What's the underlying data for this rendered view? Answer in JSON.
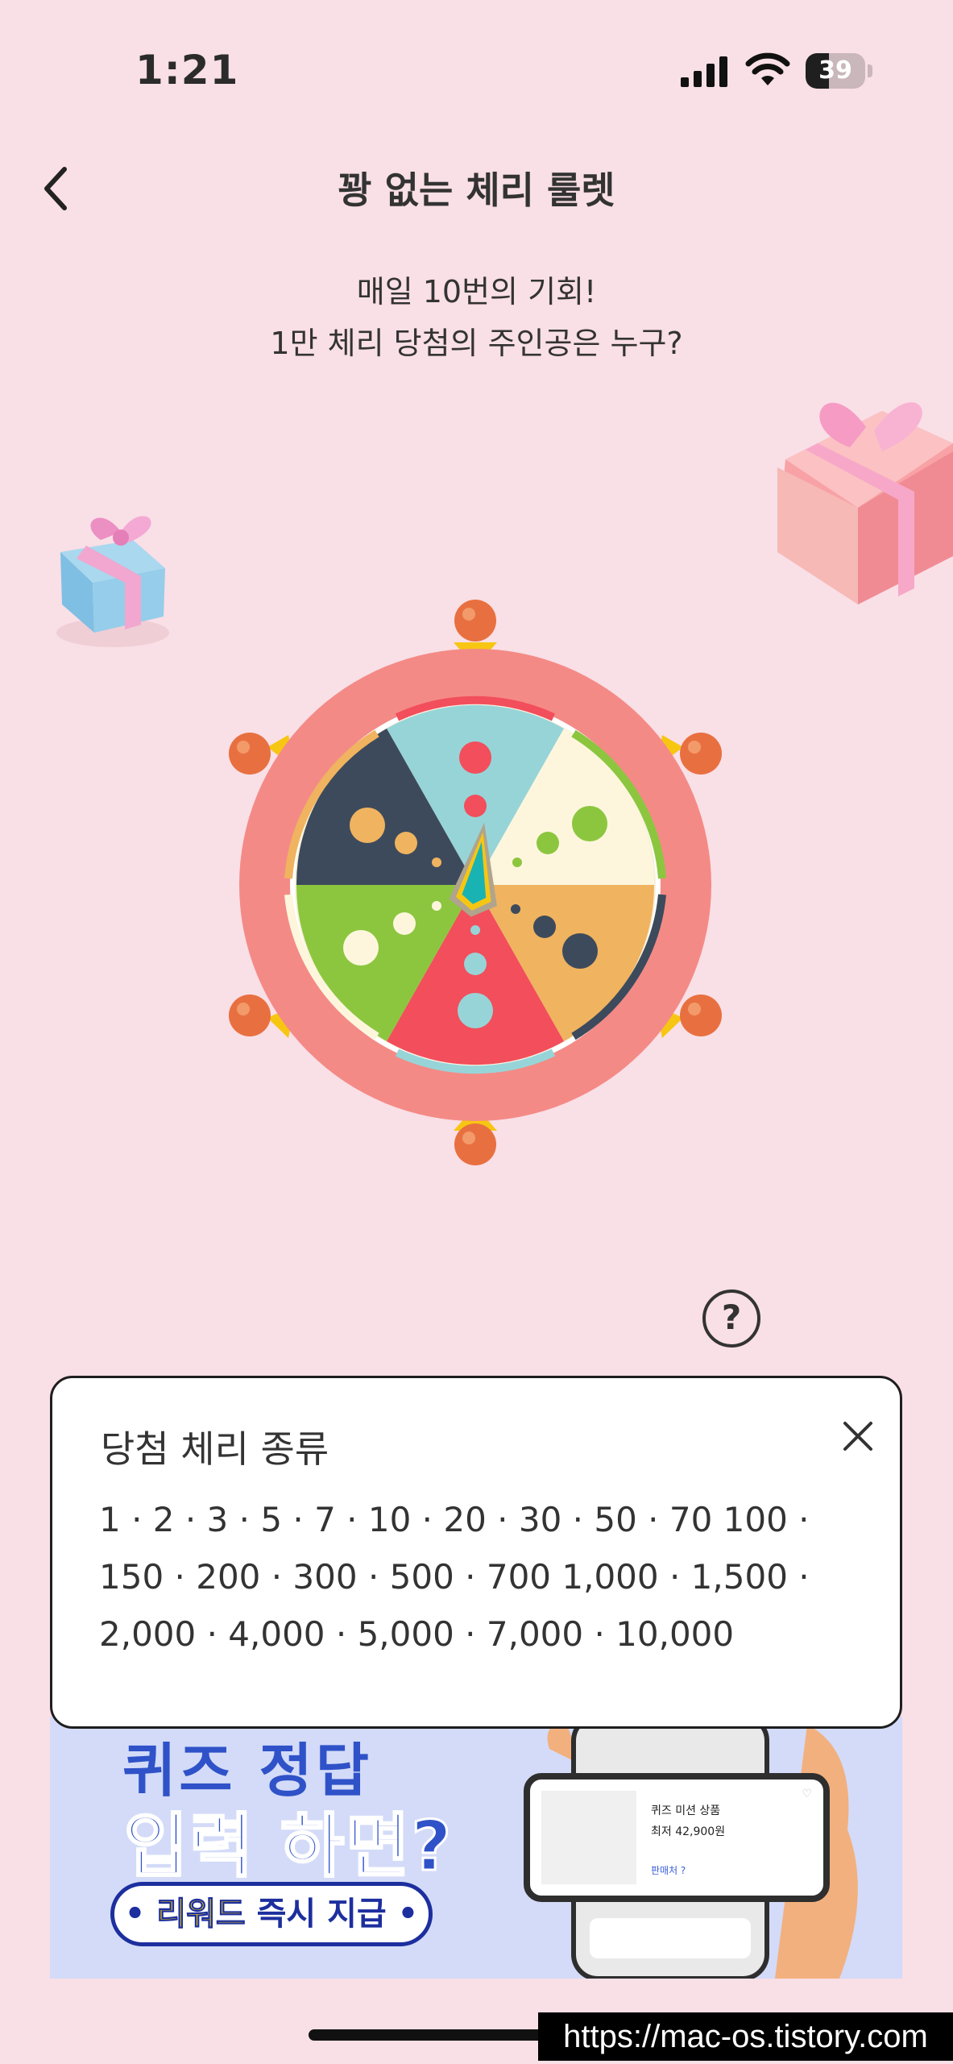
{
  "status_bar": {
    "time": "1:21",
    "battery": "39",
    "battery_level": 0.39
  },
  "nav": {
    "title": "꽝 없는 체리 룰렛"
  },
  "subtitle": {
    "line1": "매일 10번의 기회!",
    "line2": "1만 체리 당첨의 주인공은 누구?"
  },
  "help": {
    "label": "?"
  },
  "popup": {
    "title": "당첨 체리 종류",
    "values": "1 · 2 · 3 · 5 · 7 · 10 · 20 · 30 · 50 · 70 100 · 150 · 200 · 300 · 500 · 700 1,000 · 1,500 · 2,000 · 4,000 · 5,000 · 7,000 · 10,000"
  },
  "banner": {
    "line1": "퀴즈 정답",
    "line2": "입력 하면?",
    "pill_highlight": "리워드",
    "pill_rest": " 즉시 지급",
    "card": {
      "title": "퀴즈 미션 상품",
      "price": "최저 42,900원",
      "link": "판매처 ?"
    }
  },
  "watermark": "https://mac-os.tistory.com",
  "colors": {
    "background": "#f9dfe6",
    "wheel_rim": "#f48a86",
    "wheel_segments": [
      "#97d4d8",
      "#fdf6dd",
      "#f0b35f",
      "#f24e5b",
      "#8cc63f",
      "#3d4a5c"
    ],
    "knob": "#e87040",
    "pointer": "#f7c613"
  },
  "icons": [
    "back-arrow-icon",
    "signal-icon",
    "wifi-icon",
    "battery-icon",
    "gift-icon",
    "help-icon",
    "close-icon",
    "heart-icon"
  ]
}
